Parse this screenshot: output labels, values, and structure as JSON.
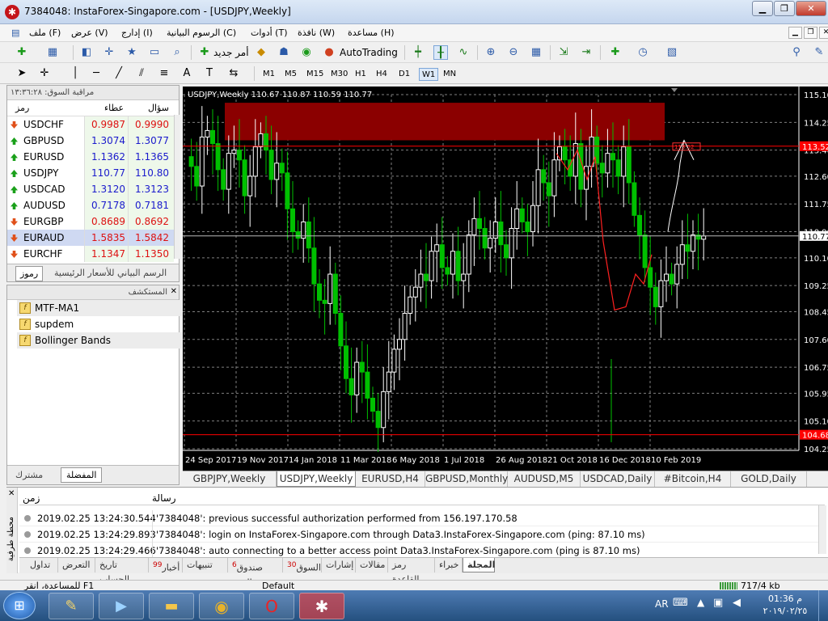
{
  "window": {
    "title": "7384048: InstaForex-Singapore.com - [USDJPY,Weekly]",
    "min": "▁",
    "restore": "❐",
    "close": "✕"
  },
  "menu": [
    "ملف (F)",
    "عرض (V)",
    "إدارج (I)",
    "الرسوم البيانية (C)",
    "أدوات (T)",
    "نافذة (W)",
    "مساعدة (H)"
  ],
  "toolbar": {
    "new_order": "أمر جديد",
    "autotrading": "AutoTrading"
  },
  "timeframes": [
    "M1",
    "M5",
    "M15",
    "M30",
    "H1",
    "H4",
    "D1",
    "W1",
    "MN"
  ],
  "active_timeframe": "W1",
  "market_watch": {
    "title": "مراقبة السوق: ١٣:٣٦:٢٨",
    "headers": {
      "symbol": "رمز",
      "bid": "عطاء",
      "ask": "سؤال"
    },
    "rows": [
      {
        "symbol": "USDCHF",
        "bid": "0.9987",
        "ask": "0.9990",
        "dir": "down"
      },
      {
        "symbol": "GBPUSD",
        "bid": "1.3074",
        "ask": "1.3077",
        "dir": "up"
      },
      {
        "symbol": "EURUSD",
        "bid": "1.1362",
        "ask": "1.1365",
        "dir": "up"
      },
      {
        "symbol": "USDJPY",
        "bid": "110.77",
        "ask": "110.80",
        "dir": "up"
      },
      {
        "symbol": "USDCAD",
        "bid": "1.3120",
        "ask": "1.3123",
        "dir": "up"
      },
      {
        "symbol": "AUDUSD",
        "bid": "0.7178",
        "ask": "0.7181",
        "dir": "up"
      },
      {
        "symbol": "EURGBP",
        "bid": "0.8689",
        "ask": "0.8692",
        "dir": "down"
      },
      {
        "symbol": "EURAUD",
        "bid": "1.5835",
        "ask": "1.5842",
        "dir": "down"
      },
      {
        "symbol": "EURCHF",
        "bid": "1.1347",
        "ask": "1.1350",
        "dir": "down"
      }
    ],
    "tabs": [
      "رموز",
      "الرسم البياني للأسعار الرئيسية"
    ]
  },
  "navigator": {
    "title": "المستكشف",
    "items": [
      "MTF-MA1",
      "supdem",
      "Bollinger Bands"
    ],
    "tabs": [
      "مشترك",
      "المفضلة"
    ]
  },
  "chart": {
    "header": "USDJPY,Weekly  110.67 110.87 110.59 110.77",
    "price_labels": [
      "115.10",
      "114.25",
      "113.40",
      "112.60",
      "111.75",
      "110.90",
      "110.10",
      "109.25",
      "108.45",
      "107.60",
      "106.75",
      "105.95",
      "105.10",
      "104.25"
    ],
    "current_price": "110.77",
    "red_line_upper": "113.52",
    "red_line_lower": "104.68",
    "box_label": "113.52",
    "date_labels": [
      "24 Sep 2017",
      "19 Nov 2017",
      "14 Jan 2018",
      "11 Mar 2018",
      "6 May 2018",
      "1 Jul 2018",
      "26 Aug 2018",
      "21 Oct 2018",
      "16 Dec 2018",
      "10 Feb 2019"
    ]
  },
  "chart_tabs": [
    "GBPJPY,Weekly",
    "USDJPY,Weekly",
    "EURUSD,H4",
    "GBPUSD,Monthly",
    "AUDUSD,M5",
    "USDCAD,Daily",
    "#Bitcoin,H4",
    "GOLD,Daily"
  ],
  "active_chart_tab": "USDJPY,Weekly",
  "terminal": {
    "side_label": "محطة طرفية",
    "headers": {
      "time": "زمن",
      "message": "رسالة"
    },
    "rows": [
      {
        "time": "2019.02.25 13:24:30.544",
        "message": "'7384048': previous successful authorization performed from 156.197.170.58"
      },
      {
        "time": "2019.02.25 13:24:29.893",
        "message": "'7384048': login on InstaForex-Singapore.com through Data3.InstaForex-Singapore.com (ping: 87.10 ms)"
      },
      {
        "time": "2019.02.25 13:24:29.466",
        "message": "'7384048': auto connecting to a better access point Data3.InstaForex-Singapore.com (ping is 87.10 ms)"
      }
    ],
    "tabs": [
      {
        "label": "تداول",
        "badge": ""
      },
      {
        "label": "التعرض",
        "badge": ""
      },
      {
        "label": "تاريخ الحساب",
        "badge": ""
      },
      {
        "label": "أخبار",
        "badge": "99"
      },
      {
        "label": "تنبيهات",
        "badge": ""
      },
      {
        "label": "صندوق البريد",
        "badge": "6"
      },
      {
        "label": "السوق",
        "badge": "30"
      },
      {
        "label": "إشارات",
        "badge": ""
      },
      {
        "label": "مقالات",
        "badge": ""
      },
      {
        "label": "رمز القاعدة",
        "badge": ""
      },
      {
        "label": "خبراء",
        "badge": ""
      },
      {
        "label": "المجلة",
        "badge": ""
      }
    ],
    "active_tab": "المجلة"
  },
  "status": {
    "help": "للمساعدة، انقر F1",
    "profile": "Default",
    "traffic": "717/4 kb"
  },
  "taskbar": {
    "lang": "AR",
    "time": "01:36 م",
    "date": "٢٠١٩/٠٢/٢٥"
  },
  "colors": {
    "bull": "#ffffff",
    "bear": "#00c000",
    "grid": "#7f7f7f",
    "supply_zone": "#8b0000",
    "red_line": "#ff0000"
  }
}
